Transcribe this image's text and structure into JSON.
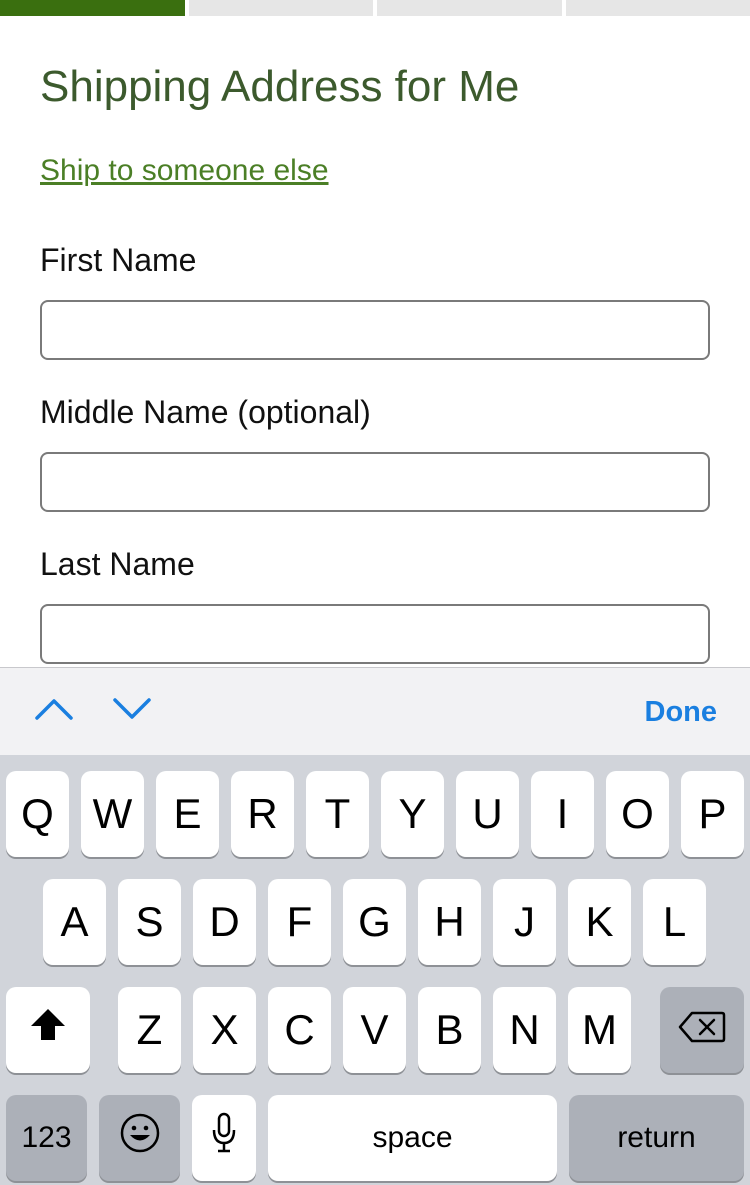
{
  "progress": {
    "total_steps": 4,
    "current_step": 1
  },
  "form": {
    "title": "Shipping Address for Me",
    "alt_link": "Ship to someone else",
    "fields": [
      {
        "label": "First Name",
        "value": ""
      },
      {
        "label": "Middle Name (optional)",
        "value": ""
      },
      {
        "label": "Last Name",
        "value": ""
      }
    ]
  },
  "accessory": {
    "prev_icon": "chevron-up-icon",
    "next_icon": "chevron-down-icon",
    "done_label": "Done"
  },
  "keyboard": {
    "row1": [
      "Q",
      "W",
      "E",
      "R",
      "T",
      "Y",
      "U",
      "I",
      "O",
      "P"
    ],
    "row2": [
      "A",
      "S",
      "D",
      "F",
      "G",
      "H",
      "J",
      "K",
      "L"
    ],
    "row3": [
      "Z",
      "X",
      "C",
      "V",
      "B",
      "N",
      "M"
    ],
    "shift_icon": "shift-icon",
    "backspace_icon": "backspace-icon",
    "numbers_label": "123",
    "emoji_icon": "emoji-icon",
    "mic_icon": "microphone-icon",
    "space_label": "space",
    "return_label": "return"
  },
  "colors": {
    "accent_green": "#3a6f0f",
    "title_green": "#3c5a2d",
    "link_green": "#4b7f26",
    "ios_blue": "#1a7fe0"
  }
}
